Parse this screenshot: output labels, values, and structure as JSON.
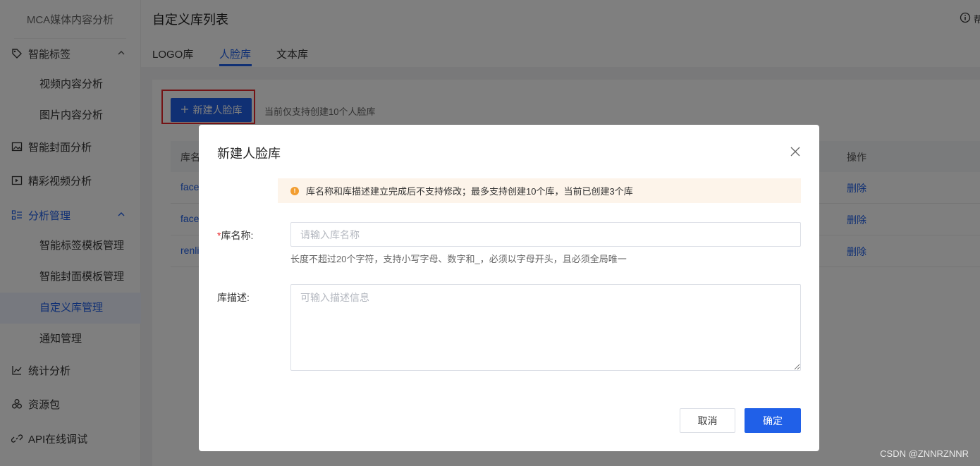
{
  "sidebar": {
    "title": "MCA媒体内容分析",
    "groups": [
      {
        "label": "智能标签",
        "icon": "tag-icon"
      },
      {
        "label": "智能封面分析",
        "icon": "image-icon"
      },
      {
        "label": "精彩视频分析",
        "icon": "video-icon"
      },
      {
        "label": "分析管理",
        "icon": "list-icon"
      },
      {
        "label": "统计分析",
        "icon": "chart-line-icon"
      },
      {
        "label": "资源包",
        "icon": "cubes-icon"
      },
      {
        "label": "API在线调试",
        "icon": "link-icon"
      }
    ],
    "subitems": {
      "video": "视频内容分析",
      "picture": "图片内容分析",
      "tag_template": "智能标签模板管理",
      "cover_template": "智能封面模板管理",
      "custom_lib": "自定义库管理",
      "notice": "通知管理"
    }
  },
  "header": {
    "title": "自定义库列表",
    "help": "帮"
  },
  "tabs": [
    {
      "label": "LOGO库"
    },
    {
      "label": "人脸库",
      "active": true
    },
    {
      "label": "文本库"
    }
  ],
  "toolbar": {
    "new_button": "新建人脸库",
    "hint": "当前仅支持创建10个人脸库"
  },
  "table": {
    "columns": {
      "name": "库名",
      "ops": "操作"
    },
    "rows": [
      {
        "name": "face_",
        "action": "删除"
      },
      {
        "name": "face_",
        "action": "删除"
      },
      {
        "name": "renli",
        "action": "删除"
      }
    ]
  },
  "modal": {
    "title": "新建人脸库",
    "alert": "库名称和库描述建立完成后不支持修改；最多支持创建10个库，当前已创建3个库",
    "name_label": "库名称:",
    "name_required_mark": "*",
    "name_placeholder": "请输入库名称",
    "name_help": "长度不超过20个字符，支持小写字母、数字和_，必须以字母开头，且必须全局唯一",
    "desc_label": "库描述:",
    "desc_placeholder": "可输入描述信息",
    "cancel": "取消",
    "confirm": "确定"
  },
  "watermark": "CSDN @ZNNRZNNR",
  "colors": {
    "primary": "#2060e8",
    "danger": "#e8262a",
    "warning": "#f29d30"
  }
}
